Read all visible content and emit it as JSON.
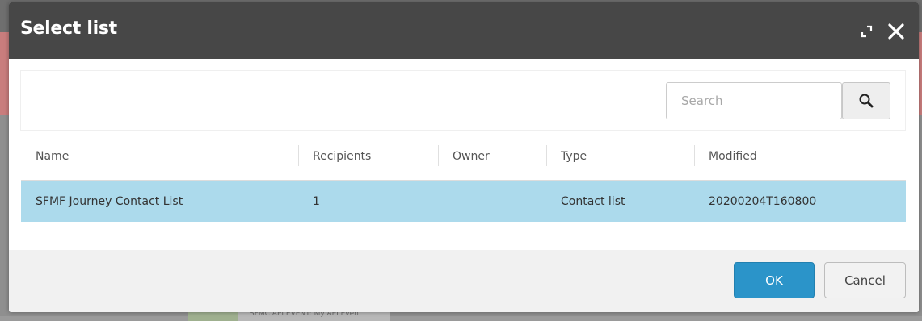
{
  "dialog": {
    "title": "Select list",
    "maximize_icon": "maximize-icon",
    "close_icon": "close-icon"
  },
  "search": {
    "placeholder": "Search",
    "value": "",
    "button_icon": "search-icon"
  },
  "table": {
    "columns": [
      "Name",
      "Recipients",
      "Owner",
      "Type",
      "Modified"
    ],
    "rows": [
      {
        "name": "SFMF Journey Contact List",
        "recipients": "1",
        "owner": "",
        "type": "Contact list",
        "modified": "20200204T160800",
        "selected": true
      }
    ]
  },
  "footer": {
    "ok_label": "OK",
    "cancel_label": "Cancel"
  },
  "background": {
    "card_text": "SFMC API EVENT: My API Even"
  },
  "colors": {
    "header": "#474747",
    "selected_row": "#acdaec",
    "primary_button": "#2b94c9"
  }
}
